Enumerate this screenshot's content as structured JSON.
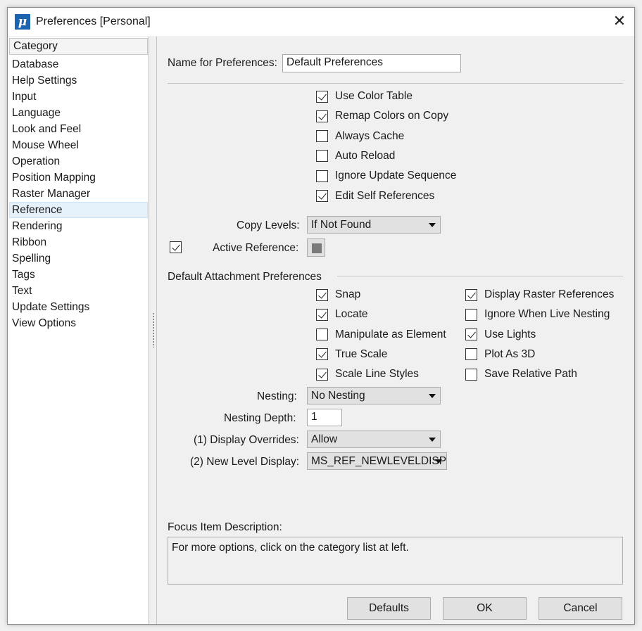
{
  "window": {
    "title": "Preferences [Personal]",
    "app_icon_glyph": "μ",
    "close_glyph": "✕"
  },
  "category": {
    "header": "Category",
    "items": [
      "Database",
      "Help Settings",
      "Input",
      "Language",
      "Look and Feel",
      "Mouse Wheel",
      "Operation",
      "Position Mapping",
      "Raster Manager",
      "Reference",
      "Rendering",
      "Ribbon",
      "Spelling",
      "Tags",
      "Text",
      "Update Settings",
      "View Options"
    ],
    "selected": "Reference"
  },
  "name_for_preferences": {
    "label": "Name for Preferences:",
    "value": "Default Preferences"
  },
  "options": [
    {
      "label": "Use Color Table",
      "checked": true
    },
    {
      "label": "Remap Colors on Copy",
      "checked": true
    },
    {
      "label": "Always Cache",
      "checked": false
    },
    {
      "label": "Auto Reload",
      "checked": false
    },
    {
      "label": "Ignore Update Sequence",
      "checked": false
    },
    {
      "label": "Edit Self References",
      "checked": true
    }
  ],
  "copy_levels": {
    "label": "Copy Levels:",
    "value": "If Not Found"
  },
  "active_reference": {
    "label": "Active Reference:",
    "checked": true,
    "swatch_color": "#7a7a7a"
  },
  "attachment": {
    "group_label": "Default Attachment Preferences",
    "left": [
      {
        "label": "Snap",
        "checked": true
      },
      {
        "label": "Locate",
        "checked": true
      },
      {
        "label": "Manipulate as Element",
        "checked": false
      },
      {
        "label": "True Scale",
        "checked": true
      },
      {
        "label": "Scale Line Styles",
        "checked": true
      }
    ],
    "right": [
      {
        "label": "Display Raster References",
        "checked": true
      },
      {
        "label": "Ignore When Live Nesting",
        "checked": false
      },
      {
        "label": "Use Lights",
        "checked": true
      },
      {
        "label": "Plot As 3D",
        "checked": false
      },
      {
        "label": "Save Relative Path",
        "checked": false
      }
    ]
  },
  "nesting": {
    "label": "Nesting:",
    "value": "No Nesting"
  },
  "nesting_depth": {
    "label": "Nesting Depth:",
    "value": "1"
  },
  "display_overrides": {
    "label": "(1) Display Overrides:",
    "value": "Allow"
  },
  "new_level_display": {
    "label": "(2) New Level Display:",
    "value": "MS_REF_NEWLEVELDISPL"
  },
  "focus": {
    "label": "Focus Item Description:",
    "text": "For more options, click on the category list at left."
  },
  "buttons": {
    "defaults": "Defaults",
    "ok": "OK",
    "cancel": "Cancel"
  }
}
